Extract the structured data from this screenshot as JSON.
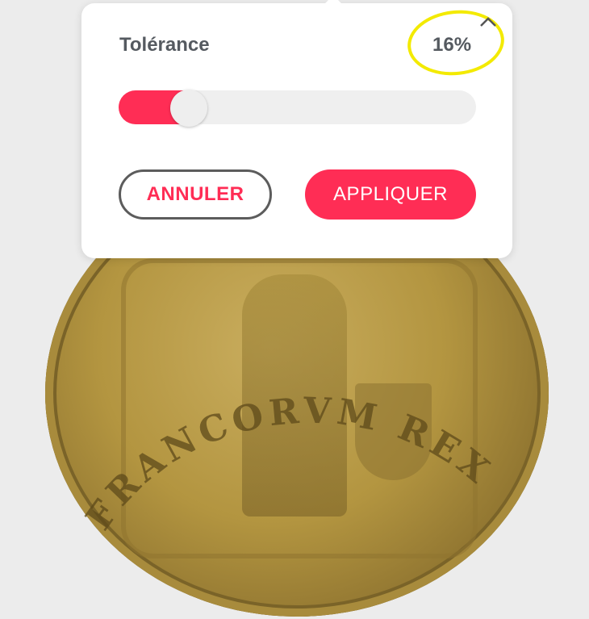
{
  "tolerance_panel": {
    "title": "Tolérance",
    "value_text": "16%",
    "value_fraction": 0.16,
    "collapse_icon": "chevron-up-icon",
    "cancel_label": "ANNULER",
    "apply_label": "APPLIQUER"
  },
  "background": {
    "description_icon": "coin-photo",
    "legend_text": "FRANCORVM REX"
  },
  "colors": {
    "accent": "#ff2d55",
    "highlight": "#f3ea00",
    "text": "#555a60",
    "track": "#efefef"
  }
}
